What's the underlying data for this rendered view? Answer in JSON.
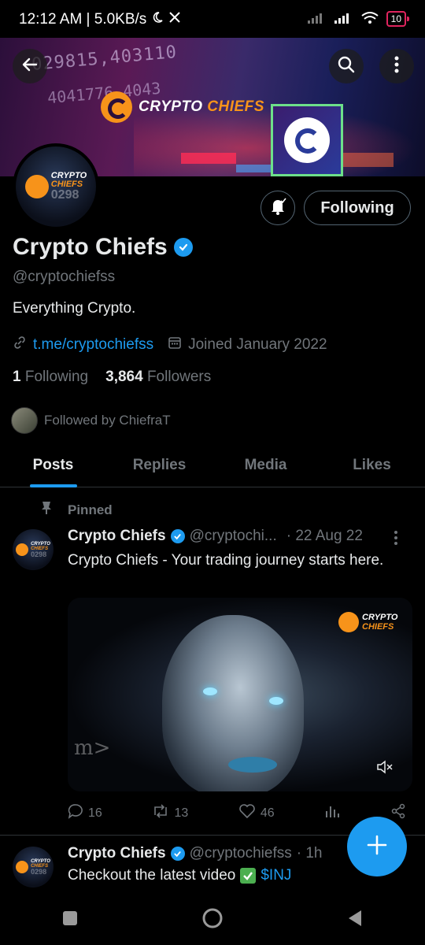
{
  "status_bar": {
    "time": "12:12 AM | 5.0KB/s",
    "battery": "10",
    "icons": [
      "moon-icon",
      "x-logo-icon",
      "signal-icon",
      "signal-icon",
      "wifi-icon",
      "battery-icon"
    ]
  },
  "banner": {
    "numbers_line1": "029815,403110",
    "numbers_line2": "4041776 4043",
    "brand_text_left": "CRYPTO",
    "brand_text_right": "CHIEFS",
    "password_mask": "*********|"
  },
  "header": {
    "back_icon": "back-arrow-icon",
    "search_icon": "search-icon",
    "more_icon": "more-vertical-icon"
  },
  "avatar": {
    "logo_line1": "CRYPTO",
    "logo_line2": "CHIEFS",
    "bg_digits": "0298"
  },
  "profile": {
    "follow_button": "Following",
    "name": "Crypto Chiefs",
    "handle": "@cryptochiefss",
    "bio": "Everything Crypto.",
    "link": "t.me/cryptochiefss",
    "joined": "Joined January 2022",
    "following_count": "1",
    "following_label": "Following",
    "followers_count": "3,864",
    "followers_label": "Followers",
    "followed_by": "Followed by ChiefraT"
  },
  "tabs": [
    {
      "label": "Posts",
      "active": true
    },
    {
      "label": "Replies",
      "active": false
    },
    {
      "label": "Media",
      "active": false
    },
    {
      "label": "Likes",
      "active": false
    }
  ],
  "pinned_tweet": {
    "pinned_label": "Pinned",
    "name": "Crypto Chiefs",
    "handle": "@cryptochi...",
    "date": "· 22 Aug 22",
    "text": "Crypto Chiefs - Your trading journey starts here.",
    "media_logo_line1": "CRYPTO",
    "media_logo_line2": "CHIEFS",
    "media_overlay_text": "m>",
    "replies": "16",
    "reposts": "13",
    "likes": "46"
  },
  "second_tweet": {
    "name": "Crypto Chiefs",
    "handle": "@cryptochiefss",
    "time": "· 1h",
    "text": "Checkout the latest video",
    "cashtag": "$INJ"
  },
  "colors": {
    "accent": "#1d9bf0",
    "brand_orange": "#f7931a",
    "muted": "#71767b",
    "text": "#e7e9ea",
    "background": "#000000"
  }
}
